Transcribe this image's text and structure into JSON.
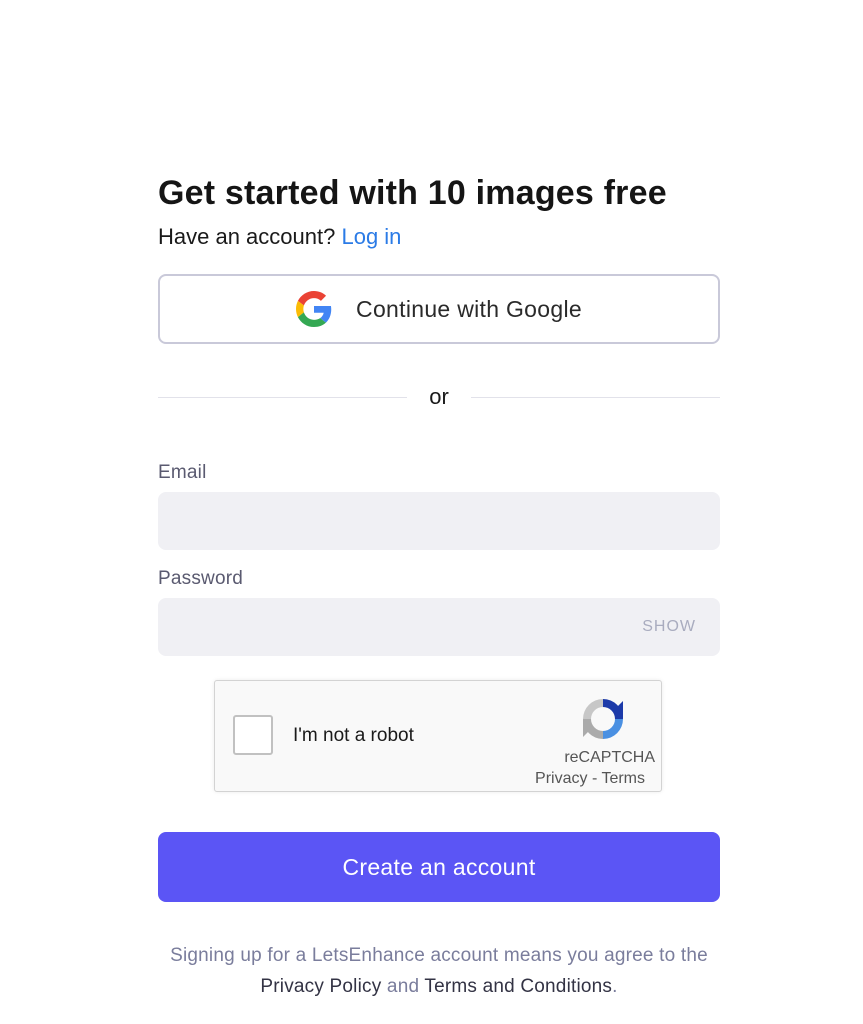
{
  "header": {
    "title": "Get started with 10 images free",
    "account_prompt": "Have an account?",
    "login_link": "Log in"
  },
  "google": {
    "label": "Continue with Google",
    "icon": "google-logo-icon"
  },
  "divider": {
    "label": "or"
  },
  "email": {
    "label": "Email",
    "value": "",
    "placeholder": ""
  },
  "password": {
    "label": "Password",
    "value": "",
    "placeholder": "",
    "show_label": "SHOW"
  },
  "recaptcha": {
    "checkbox_label": "I'm not a robot",
    "brand": "reCAPTCHA",
    "privacy": "Privacy",
    "separator": "-",
    "terms": "Terms",
    "icon": "recaptcha-logo-icon"
  },
  "submit": {
    "label": "Create an account"
  },
  "legal": {
    "text_before": "Signing up for a LetsEnhance account means you agree to the",
    "privacy_link": "Privacy Policy",
    "and": "and",
    "terms_link": "Terms and Conditions",
    "period": "."
  },
  "colors": {
    "accent": "#5b55f5",
    "link": "#2b7be6",
    "input_bg": "#f0f0f4",
    "muted": "#7a7d9c"
  }
}
